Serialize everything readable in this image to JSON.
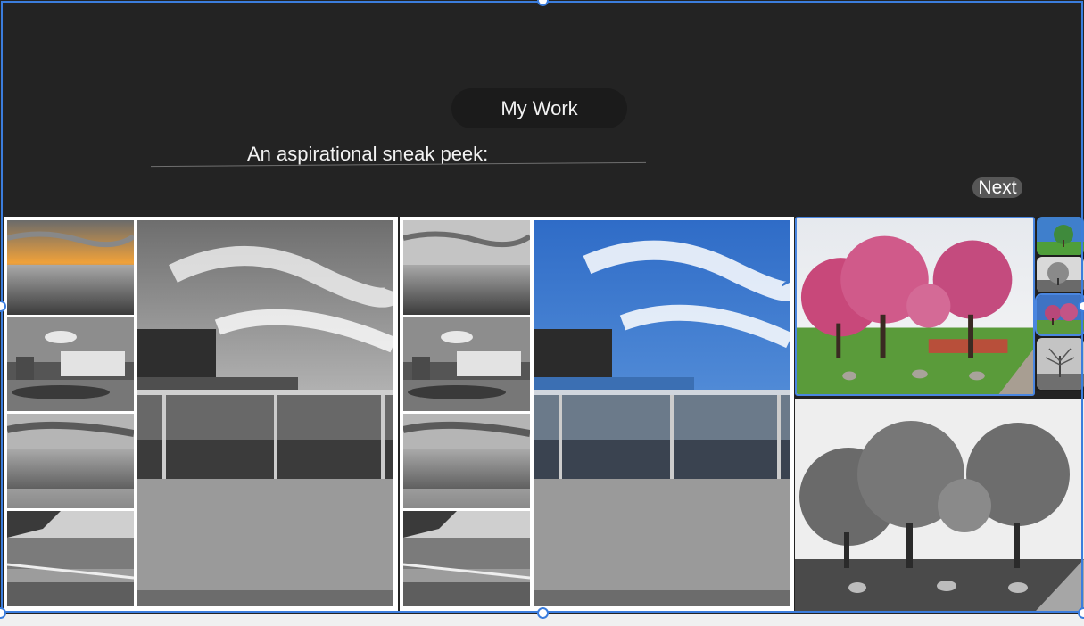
{
  "header": {
    "pill_title": "My Work",
    "subtitle": "An aspirational sneak peek:",
    "next_label": "Next"
  },
  "colors": {
    "background": "#232323",
    "selection": "#3b7ddd",
    "next_button": "#575757"
  },
  "collages": [
    {
      "name": "collage-black-and-white",
      "thumbnails": [
        "sunset-sea-photo",
        "hotel-building-photo",
        "sea-horizon-photo",
        "pier-railing-photo"
      ],
      "main": "opera-house-waterfront-bw"
    },
    {
      "name": "collage-color-accent",
      "thumbnails": [
        "sea-horizon-photo",
        "hotel-building-photo",
        "sea-horizon-photo",
        "pier-railing-photo"
      ],
      "main": "opera-house-waterfront-color"
    }
  ],
  "gallery": {
    "featured": "cherry-blossom-trees-color",
    "below": "cherry-blossom-trees-bw",
    "thumbnail_strip": [
      "tree-color-thumb",
      "tree-bw-thumb",
      "tree-color-selected-thumb",
      "bare-tree-bw-thumb"
    ]
  }
}
